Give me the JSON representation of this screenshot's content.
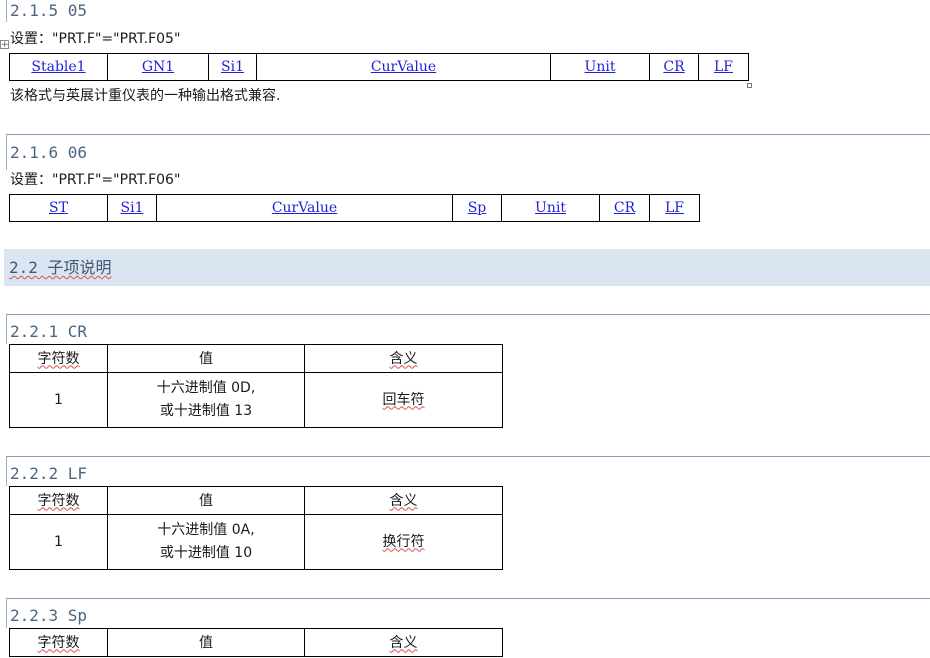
{
  "s215": {
    "heading": "2.1.5 05",
    "setting": "设置：\"PRT.F\"=\"PRT.F05\"",
    "fields": [
      "Stable1",
      "GN1",
      "Si1",
      "CurValue",
      "Unit",
      "CR",
      "LF"
    ],
    "note": "该格式与英展计重仪表的一种输出格式兼容."
  },
  "s216": {
    "heading": "2.1.6 06",
    "setting": "设置：\"PRT.F\"=\"PRT.F06\"",
    "fields": [
      "ST",
      "Si1",
      "CurValue",
      "Sp",
      "Unit",
      "CR",
      "LF"
    ]
  },
  "s22": {
    "heading": "2.2 子项说明"
  },
  "s221": {
    "heading": "2.2.1 CR",
    "header": [
      "字符数",
      "值",
      "含义"
    ],
    "count": "1",
    "value_line1": "十六进制值 0D,",
    "value_line2": "或十进制值 13",
    "meaning": "回车符"
  },
  "s222": {
    "heading": "2.2.2 LF",
    "header": [
      "字符数",
      "值",
      "含义"
    ],
    "count": "1",
    "value_line1": "十六进制值 0A,",
    "value_line2": "或十进制值 10",
    "meaning": "换行符"
  },
  "s223": {
    "heading": "2.2.3 Sp",
    "header": [
      "字符数",
      "值",
      "含义"
    ]
  },
  "icons": {
    "move": "table-move-handle-icon",
    "resize": "table-resize-handle-icon"
  }
}
